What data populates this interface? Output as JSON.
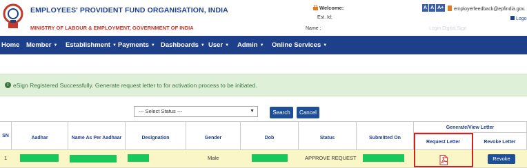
{
  "header": {
    "org_title": "EMPLOYEES' PROVIDENT FUND ORGANISATION, INDIA",
    "ministry": "MINISTRY OF LABOUR & EMPLOYMENT, GOVERNMENT OF INDIA",
    "welcome_label": "Welcome:",
    "est_id_label": "Est. Id:",
    "name_label": "Name :",
    "font_buttons": [
      "A",
      "A",
      "A+"
    ],
    "feedback_email": "employerfeedback@epfindia.gov.",
    "logout_label": "Logo",
    "faded_label": "Login Digital Sign"
  },
  "nav": {
    "items": [
      "Home",
      "Member",
      "Establishment",
      "Payments",
      "Dashboards",
      "User",
      "Admin",
      "Online Services"
    ]
  },
  "alert": {
    "message": "eSign Registered Successfully. Generate request letter to for activation process to be initiated."
  },
  "filter": {
    "status_selected": "--- Select Status ---",
    "search_label": "Search",
    "cancel_label": "Cancel"
  },
  "table": {
    "headers": {
      "sn": "SN",
      "aadhar": "Aadhar",
      "name": "Name As Per Aadhaar",
      "designation": "Designation",
      "gender": "Gender",
      "dob": "Dob",
      "status": "Status",
      "submitted_on": "Submitted On",
      "group": "Generate/View Letter",
      "request_letter": "Request Letter",
      "revoke_letter": "Revoke Letter"
    },
    "rows": [
      {
        "sn": "1",
        "gender": "Male",
        "status": "APPROVE REQUEST",
        "revoke_label": "Revoke"
      }
    ]
  },
  "colors": {
    "nav_bg": "#1e3f8a",
    "alert_bg": "#dff0d8",
    "row_bg": "#fbf6c5",
    "highlight": "#d41f1f",
    "redaction": "#16c95a"
  }
}
